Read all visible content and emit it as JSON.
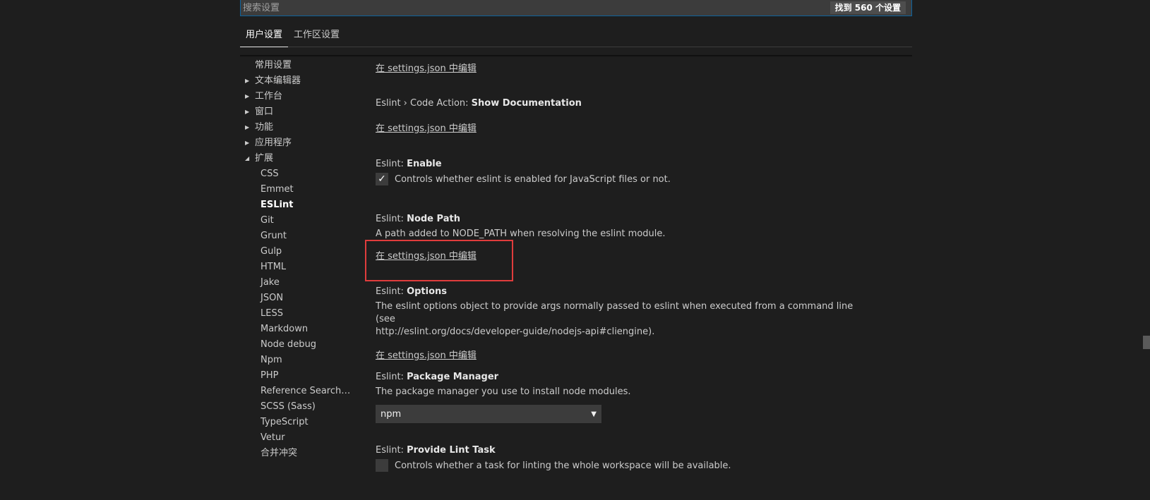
{
  "search": {
    "placeholder": "搜索设置",
    "result_count": "找到 560 个设置"
  },
  "tabs": [
    {
      "label": "用户设置",
      "active": true
    },
    {
      "label": "工作区设置",
      "active": false
    }
  ],
  "toc": {
    "items": [
      {
        "label": "常用设置"
      },
      {
        "label": "文本编辑器",
        "twistie": "▶"
      },
      {
        "label": "工作台",
        "twistie": "▶"
      },
      {
        "label": "窗口",
        "twistie": "▶"
      },
      {
        "label": "功能",
        "twistie": "▶"
      },
      {
        "label": "应用程序",
        "twistie": "▶"
      },
      {
        "label": "扩展",
        "twistie": "◢"
      }
    ],
    "extensions": [
      "CSS",
      "Emmet",
      "ESLint",
      "Git",
      "Grunt",
      "Gulp",
      "HTML",
      "Jake",
      "JSON",
      "LESS",
      "Markdown",
      "Node debug",
      "Npm",
      "PHP",
      "Reference Search V...",
      "SCSS (Sass)",
      "TypeScript",
      "Vetur",
      "合并冲突"
    ],
    "selected": "ESLint"
  },
  "settings": {
    "edit_link": "在 settings.json 中编辑",
    "code_action": {
      "prefix": "Eslint › Code Action: ",
      "name": "Show Documentation"
    },
    "enable": {
      "prefix": "Eslint: ",
      "name": "Enable",
      "desc": "Controls whether eslint is enabled for JavaScript files or not.",
      "checked": true,
      "check_glyph": "✓"
    },
    "node_path": {
      "prefix": "Eslint: ",
      "name": "Node Path",
      "desc": "A path added to NODE_PATH when resolving the eslint module."
    },
    "options": {
      "prefix": "Eslint: ",
      "name": "Options",
      "desc_line1": "The eslint options object to provide args normally passed to eslint when executed from a command line (see",
      "desc_line2": "http://eslint.org/docs/developer-guide/nodejs-api#cliengine)."
    },
    "package_manager": {
      "prefix": "Eslint: ",
      "name": "Package Manager",
      "desc": "The package manager you use to install node modules.",
      "value": "npm",
      "chevron": "▼"
    },
    "provide_lint_task": {
      "prefix": "Eslint: ",
      "name": "Provide Lint Task",
      "desc": "Controls whether a task for linting the whole workspace will be available.",
      "checked": false
    }
  },
  "colors": {
    "background": "#1e1e1e",
    "input_background": "#3c3c3c",
    "focus_border": "#0e639c",
    "highlight": "#e03c3c"
  }
}
